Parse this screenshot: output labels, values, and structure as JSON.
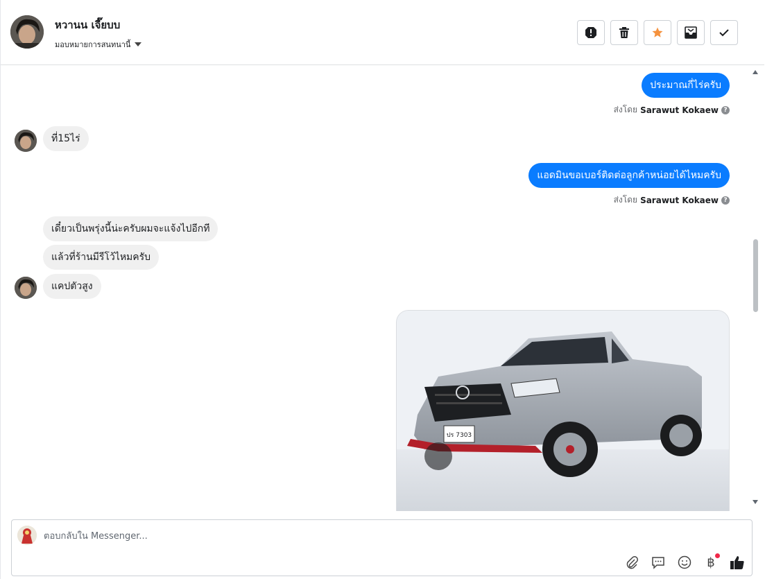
{
  "header": {
    "contact_name": "หวานน เจี๊ยบบ",
    "assign_label": "มอบหมายการสนทนานี้",
    "toolbar": [
      {
        "icon": "alert-icon",
        "name": "mark-spam-button"
      },
      {
        "icon": "trash-icon",
        "name": "delete-button"
      },
      {
        "icon": "star-icon",
        "name": "star-button"
      },
      {
        "icon": "mark-unread-icon",
        "name": "mark-unread-button"
      },
      {
        "icon": "check-icon",
        "name": "mark-done-button"
      }
    ]
  },
  "messages": {
    "out_1": "ประมาณกี่ไร่ครับ",
    "in_1": "ที่15ไร่",
    "out_2": "แอดมินขอเบอร์ติดต่อลูกค้าหน่อยได้ไหมครับ",
    "in_2": "เดี๋ยวเป็นพรุ่งนี้น่ะครับผมจะแจ้งไปอีกที",
    "in_3": "แล้วที่ร้านมีรีโว้ไหมครับ",
    "in_4": "แคปตัวสูง",
    "photo_plate": "ปร 7303"
  },
  "sent_by": {
    "prefix": "ส่งโดย",
    "name": "Sarawut Kokaew",
    "help": "?"
  },
  "composer": {
    "placeholder": "ตอบกลับใน Messenger...",
    "baht_symbol": "฿"
  },
  "colors": {
    "outgoing_bubble": "#0a7cff",
    "incoming_bubble": "#f0f0f0",
    "star": "#f5923e",
    "notification_dot": "#f02849"
  }
}
